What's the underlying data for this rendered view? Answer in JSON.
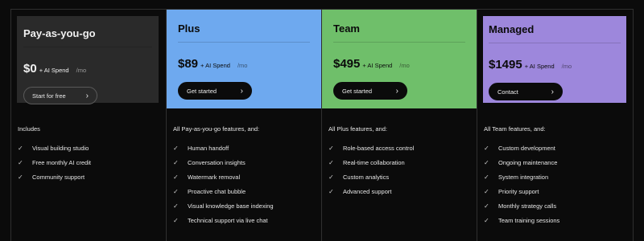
{
  "plans": [
    {
      "title": "Pay-as-you-go",
      "price": "$0",
      "price_suffix": "+ AI Spend",
      "period": "/mo",
      "cta": "Start for free",
      "card_bg": "#2a2a2a",
      "card_text": "#f0f0f0",
      "cta_bg": "#2a2a2a",
      "cta_text": "#e8e8e8",
      "cta_border": "#5a5a5a",
      "features_heading": "Includes",
      "features": [
        "Visual building studio",
        "Free monthly AI credit",
        "Community support"
      ]
    },
    {
      "title": "Plus",
      "price": "$89",
      "price_suffix": "+ AI Spend",
      "period": "/mo",
      "cta": "Get started",
      "card_bg": "#6ea9ef",
      "card_text": "#0b0b0b",
      "cta_bg": "#0b0b0b",
      "cta_text": "#f0f0f0",
      "cta_border": "#0b0b0b",
      "features_heading": "All Pay-as-you-go features, and:",
      "features": [
        "Human handoff",
        "Conversation insights",
        "Watermark removal",
        "Proactive chat bubble",
        "Visual knowledge base indexing",
        "Technical support via live chat"
      ]
    },
    {
      "title": "Team",
      "price": "$495",
      "price_suffix": "+ AI Spend",
      "period": "/mo",
      "cta": "Get started",
      "card_bg": "#6fbf6a",
      "card_text": "#0b0b0b",
      "cta_bg": "#0b0b0b",
      "cta_text": "#f0f0f0",
      "cta_border": "#0b0b0b",
      "features_heading": "All Plus features, and:",
      "features": [
        "Role-based access control",
        "Real-time collaboration",
        "Custom analytics",
        "Advanced support"
      ]
    },
    {
      "title": "Managed",
      "price": "$1495",
      "price_suffix": "+ AI Spend",
      "period": "/mo",
      "cta": "Contact",
      "card_bg": "#9d87dc",
      "card_text": "#0b0b0b",
      "cta_bg": "#0b0b0b",
      "cta_text": "#f0f0f0",
      "cta_border": "#0b0b0b",
      "features_heading": "All Team features, and:",
      "features": [
        "Custom development",
        "Ongoing maintenance",
        "System integration",
        "Priority support",
        "Monthly strategy calls",
        "Team training sessions"
      ]
    }
  ],
  "icons": {
    "cta_arrow": "chevron-right-icon",
    "feature_check": "check-icon"
  }
}
